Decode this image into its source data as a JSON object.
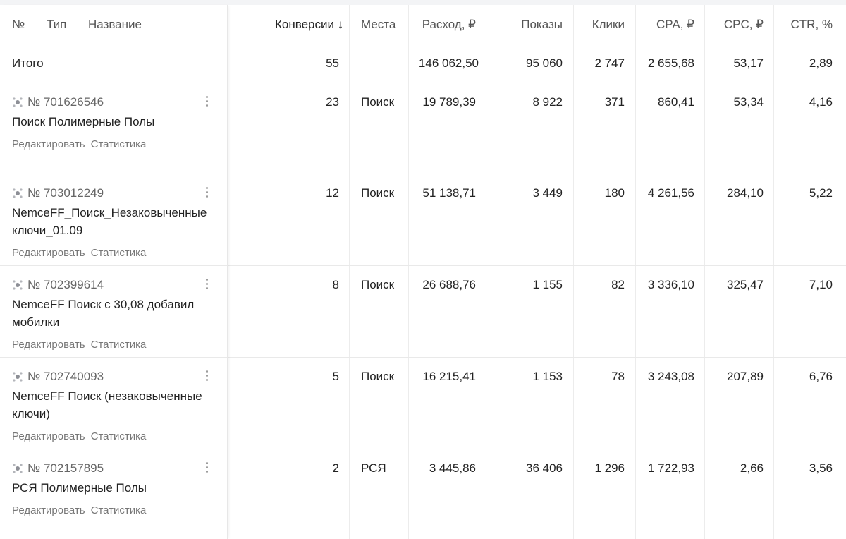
{
  "headers": {
    "num": "№",
    "type": "Тип",
    "name": "Название",
    "conversions": "Конверсии ↓",
    "places": "Места",
    "spend": "Расход, ₽",
    "impressions": "Показы",
    "clicks": "Клики",
    "cpa": "CPA, ₽",
    "cpc": "CPC, ₽",
    "ctr": "CTR, %"
  },
  "totals": {
    "label": "Итого",
    "conversions": "55",
    "places": "",
    "spend": "146 062,50",
    "impressions": "95 060",
    "clicks": "2 747",
    "cpa": "2 655,68",
    "cpc": "53,17",
    "ctr": "2,89"
  },
  "actions": {
    "edit": "Редактировать",
    "stats": "Статистика"
  },
  "campaigns": [
    {
      "id": "№ 701626546",
      "name": "Поиск Полимерные Полы",
      "conversions": "23",
      "places": "Поиск",
      "spend": "19 789,39",
      "impressions": "8 922",
      "clicks": "371",
      "cpa": "860,41",
      "cpc": "53,34",
      "ctr": "4,16"
    },
    {
      "id": "№ 703012249",
      "name": "NemceFF_Поиск_Незаковыченные ключи_01.09",
      "conversions": "12",
      "places": "Поиск",
      "spend": "51 138,71",
      "impressions": "3 449",
      "clicks": "180",
      "cpa": "4 261,56",
      "cpc": "284,10",
      "ctr": "5,22"
    },
    {
      "id": "№ 702399614",
      "name": "NemceFF Поиск с 30,08 добавил мобилки",
      "conversions": "8",
      "places": "Поиск",
      "spend": "26 688,76",
      "impressions": "1 155",
      "clicks": "82",
      "cpa": "3 336,10",
      "cpc": "325,47",
      "ctr": "7,10"
    },
    {
      "id": "№ 702740093",
      "name": "NemceFF Поиск (незаковыченные ключи)",
      "conversions": "5",
      "places": "Поиск",
      "spend": "16 215,41",
      "impressions": "1 153",
      "clicks": "78",
      "cpa": "3 243,08",
      "cpc": "207,89",
      "ctr": "6,76"
    },
    {
      "id": "№ 702157895",
      "name": "РСЯ Полимерные Полы",
      "conversions": "2",
      "places": "РСЯ",
      "spend": "3 445,86",
      "impressions": "36 406",
      "clicks": "1 296",
      "cpa": "1 722,93",
      "cpc": "2,66",
      "ctr": "3,56"
    }
  ]
}
